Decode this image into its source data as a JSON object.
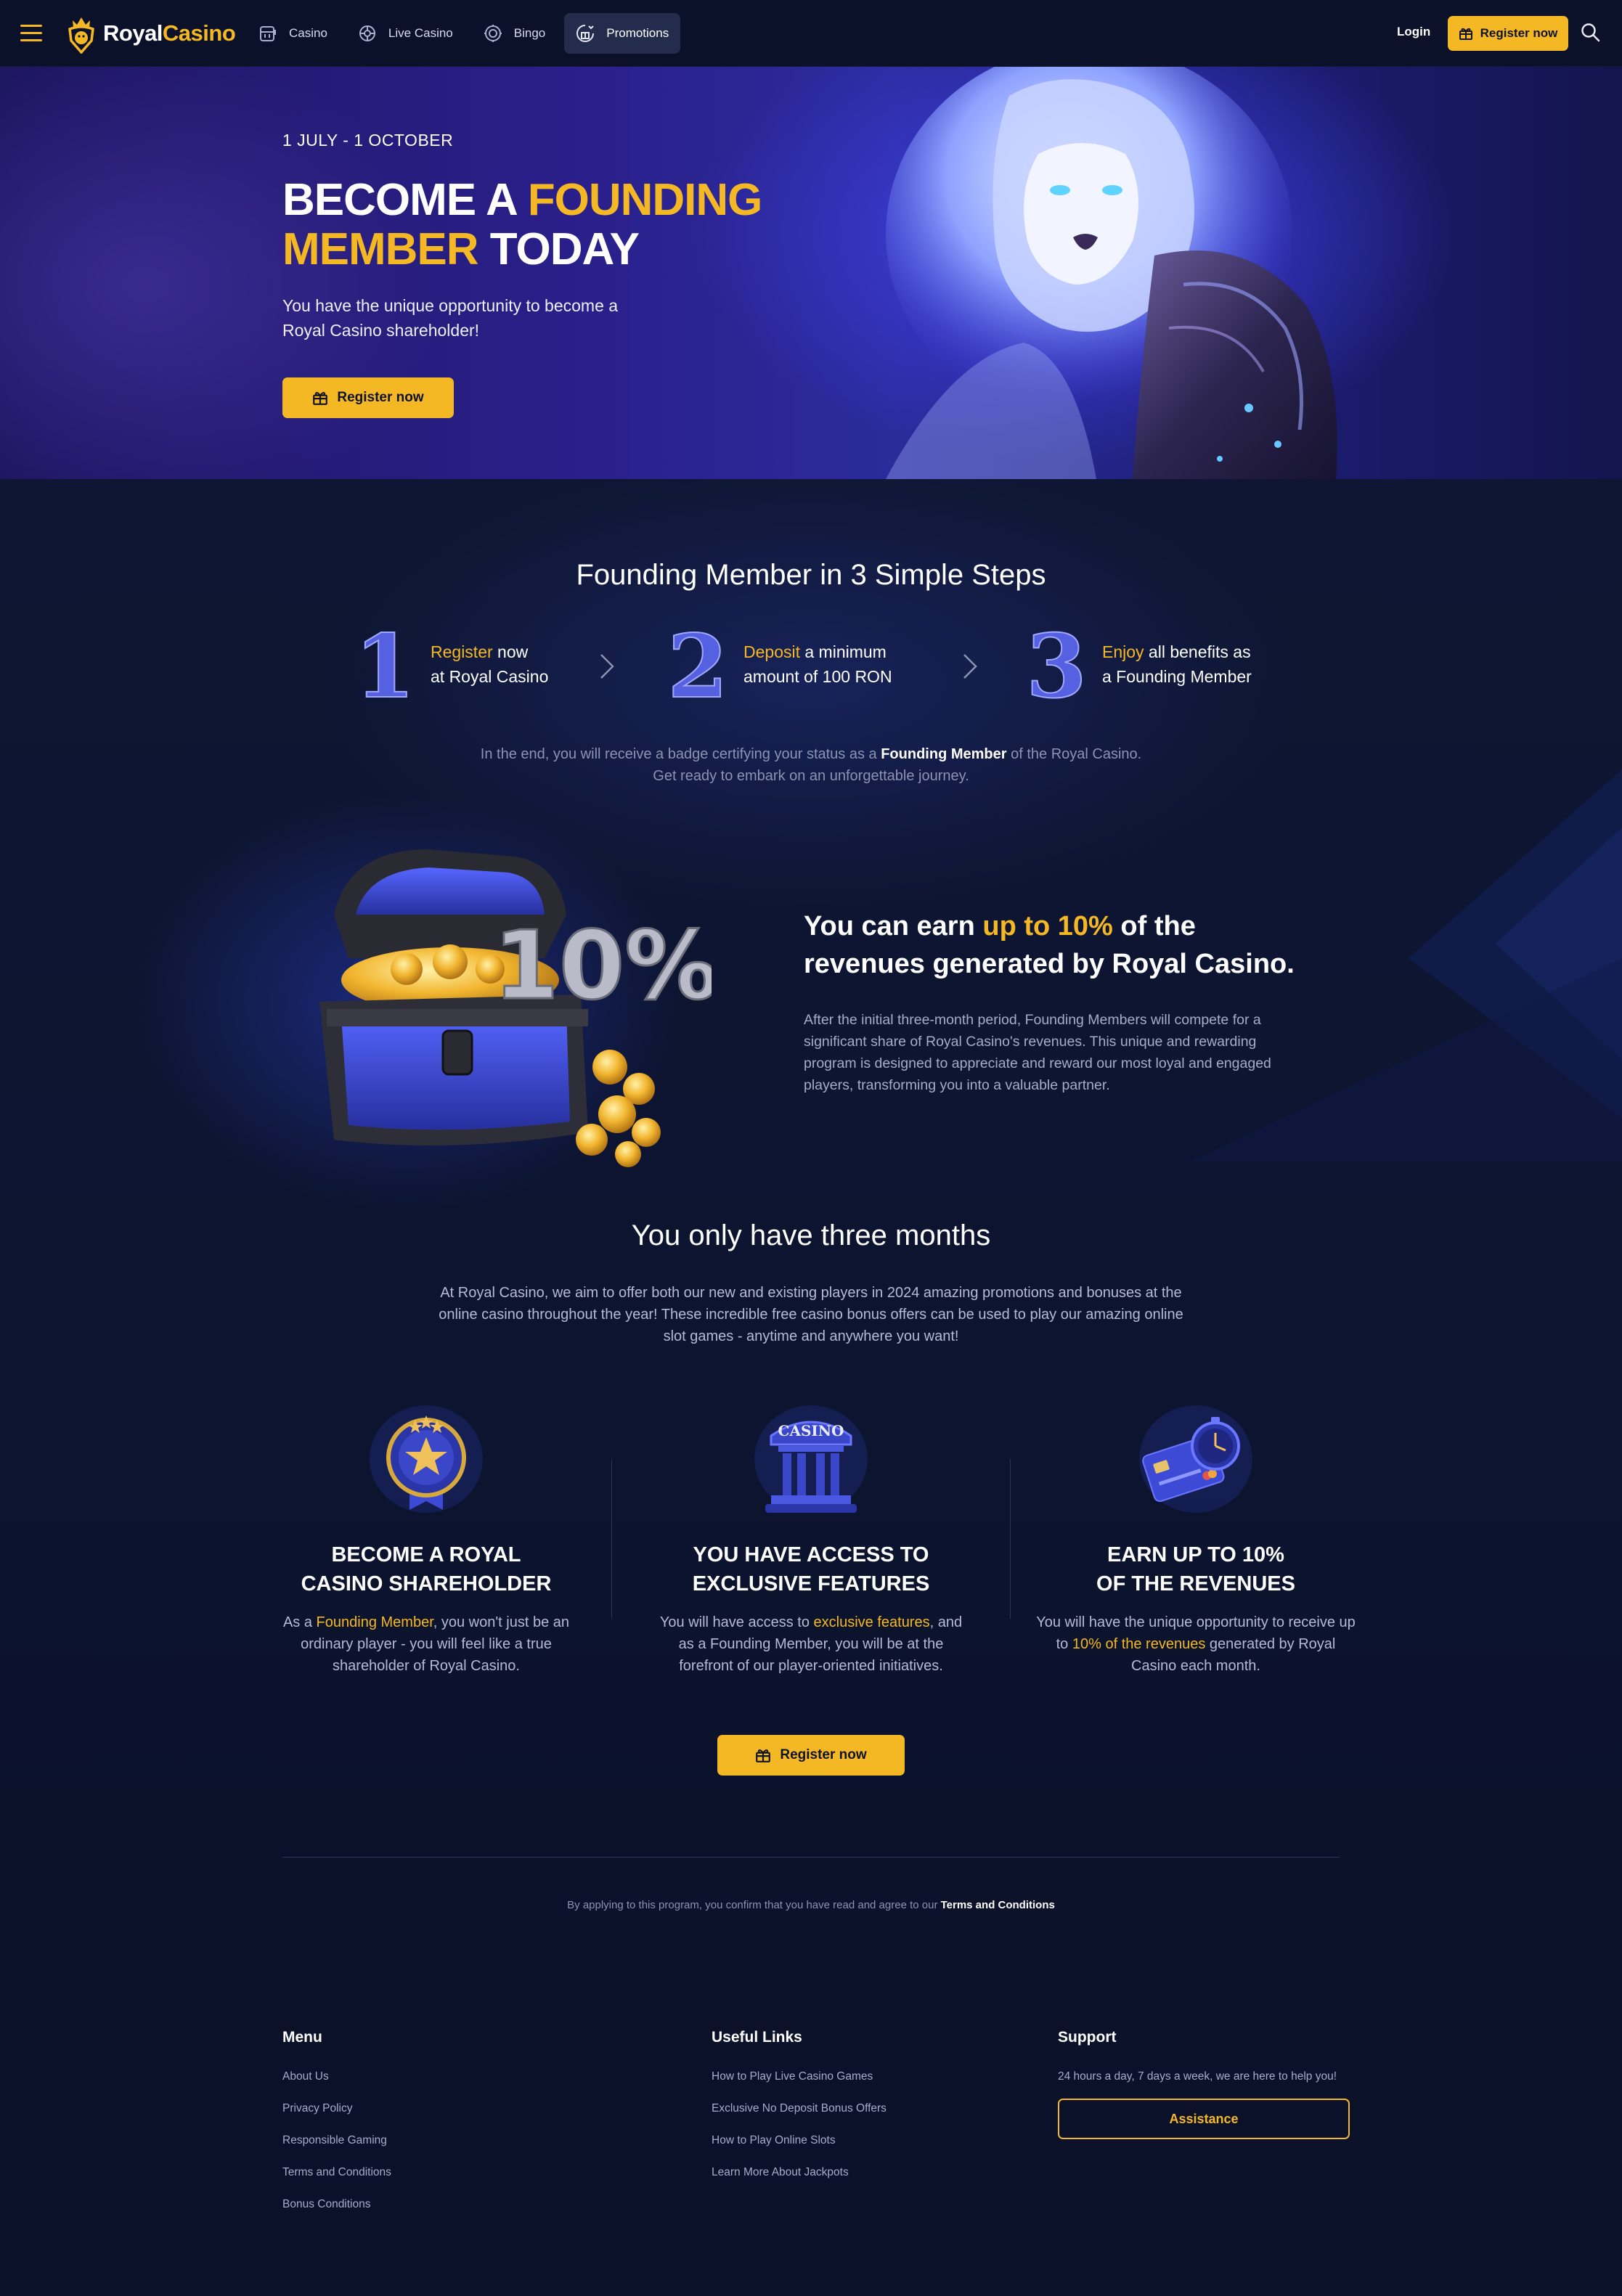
{
  "header": {
    "logo_royal": "Royal",
    "logo_casino": "Casino",
    "nav": [
      {
        "label": "Casino",
        "icon": "slot-machine-icon"
      },
      {
        "label": "Live Casino",
        "icon": "roulette-icon"
      },
      {
        "label": "Bingo",
        "icon": "bingo-ball-icon"
      },
      {
        "label": "Promotions",
        "icon": "gift-badge-icon",
        "active": true
      }
    ],
    "login": "Login",
    "register": "Register now"
  },
  "hero": {
    "date": "1 JULY - 1 OCTOBER",
    "title_a": "BECOME A ",
    "title_b": "FOUNDING",
    "title_c": "MEMBER",
    "title_d": " TODAY",
    "subtitle": "You have the unique opportunity to become a Royal Casino shareholder!",
    "button": "Register now"
  },
  "steps": {
    "title": "Founding Member in 3 Simple Steps",
    "items": [
      {
        "num": "1",
        "highlight": "Register",
        "rest1": " now",
        "rest2": "at Royal Casino"
      },
      {
        "num": "2",
        "highlight": "Deposit",
        "rest1": " a minimum",
        "rest2": "amount of 100 RON"
      },
      {
        "num": "3",
        "highlight": "Enjoy",
        "rest1": " all benefits as",
        "rest2": "a Founding Member"
      }
    ],
    "note_a": "In the end, you will receive a badge certifying your status as a ",
    "note_b": "Founding Member",
    "note_c": " of the Royal Casino.",
    "note_d": "Get ready to embark on an unforgettable journey."
  },
  "earn": {
    "chest_label": "10%",
    "title_a": "You can earn ",
    "title_b": "up to 10%",
    "title_c": " of the",
    "title_d": "revenues generated by Royal Casino.",
    "text": "After the initial three-month period, Founding Members will compete for a significant share of Royal Casino's revenues. This unique and rewarding program is designed to appreciate and reward our most loyal and engaged players, transforming you into a valuable partner."
  },
  "three": {
    "title": "You only have three months",
    "text": "At Royal Casino, we aim to offer both our new and existing players in 2024 amazing promotions and bonuses at the online casino throughout the year! These incredible free casino bonus offers can be used to play our amazing online slot games - anytime and anywhere you want!"
  },
  "features": [
    {
      "icon": "star-medal-icon",
      "title1": "BECOME A ROYAL",
      "title2": "CASINO SHAREHOLDER",
      "t_a": "As a ",
      "t_b": "Founding Member",
      "t_c": ", you won't just be an ordinary player - you will feel like a true shareholder of Royal Casino."
    },
    {
      "icon": "casino-building-icon",
      "sign": "CASINO",
      "title1": "YOU HAVE ACCESS TO",
      "title2": "EXCLUSIVE FEATURES",
      "t_a": "You will have access to ",
      "t_b": "exclusive features",
      "t_c": ", and as a Founding Member, you will be at the forefront of our player-oriented initiatives."
    },
    {
      "icon": "card-stopwatch-icon",
      "title1": "EARN UP TO 10%",
      "title2": "OF THE REVENUES",
      "t_a": "You will have the unique opportunity to receive up to ",
      "t_b": "10% of the revenues",
      "t_c": " generated by Royal Casino each month."
    }
  ],
  "cta": "Register now",
  "agree_a": "By applying to this program, you confirm that you have read and agree to our ",
  "agree_b": "Terms and Conditions",
  "footer": {
    "menu_title": "Menu",
    "menu": [
      "About Us",
      "Privacy Policy",
      "Responsible Gaming",
      "Terms and Conditions",
      "Bonus Conditions"
    ],
    "links_title": "Useful Links",
    "links": [
      "How to Play Live Casino Games",
      "Exclusive No Deposit Bonus Offers",
      "How to Play Online Slots",
      "Learn More About Jackpots"
    ],
    "support_title": "Support",
    "support_text": "24 hours a day, 7 days a week, we are here to help you!",
    "assistance": "Assistance"
  },
  "colors": {
    "accent": "#f5b825",
    "background": "#0b1128",
    "nav_active": "#232c4c"
  }
}
